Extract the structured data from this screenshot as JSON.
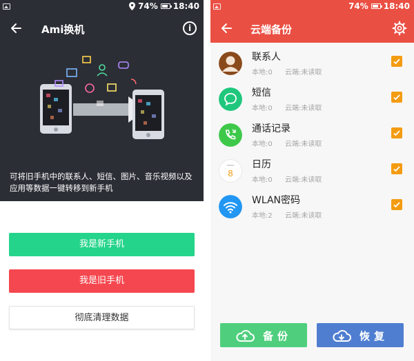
{
  "left": {
    "status": {
      "battery": "74%",
      "time": "18:40"
    },
    "title": "Ami换机",
    "description": "可将旧手机中的联系人、短信、图片、音乐视频以及应用等数据一键转移到新手机",
    "buttons": {
      "new_phone": "我是新手机",
      "old_phone": "我是旧手机",
      "clear_data": "彻底清理数据"
    },
    "colors": {
      "hero_bg": "#2c2e36",
      "new": "#24d48a",
      "old": "#f5474f"
    }
  },
  "right": {
    "status": {
      "battery": "74%",
      "time": "18:40"
    },
    "title": "云端备份",
    "items": [
      {
        "name": "联系人",
        "local": "本地:0",
        "cloud": "云端:未读取",
        "icon": "contact-avatar-icon",
        "checked": true
      },
      {
        "name": "短信",
        "local": "本地:0",
        "cloud": "云端:未读取",
        "icon": "message-icon",
        "checked": true
      },
      {
        "name": "通话记录",
        "local": "本地:0",
        "cloud": "云端:未读取",
        "icon": "phone-icon",
        "checked": true
      },
      {
        "name": "日历",
        "local": "本地:0",
        "cloud": "云端:未读取",
        "icon": "calendar-icon",
        "calendar_day": "8",
        "checked": true
      },
      {
        "name": "WLAN密码",
        "local": "本地:2",
        "cloud": "云端:未读取",
        "icon": "wifi-icon",
        "checked": true
      }
    ],
    "buttons": {
      "backup": "备份",
      "restore": "恢复"
    },
    "colors": {
      "header": "#ea4f43",
      "check": "#f39c12",
      "backup": "#4fcf7d",
      "restore": "#4f7ed1"
    }
  }
}
